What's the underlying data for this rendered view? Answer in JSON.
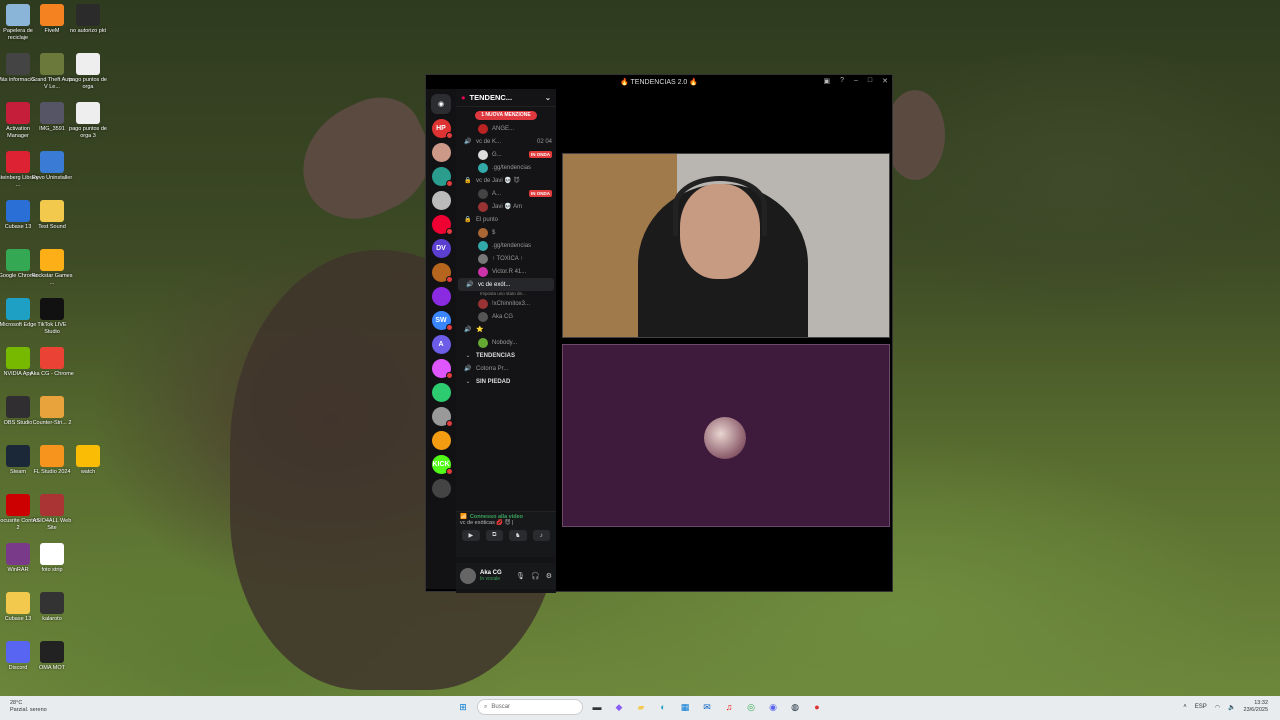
{
  "desktop_icons": [
    {
      "label": "Papelera de reciclaje",
      "icon": "recycle-bin-icon",
      "color": "#8ab4d8"
    },
    {
      "label": "FiveM",
      "icon": "fivem-icon",
      "color": "#f58220"
    },
    {
      "label": "no autorizo pkt",
      "icon": "file-icon",
      "color": "#2b2b2b"
    },
    {
      "label": "Más informació...",
      "icon": "info-icon",
      "color": "#444"
    },
    {
      "label": "Grand Theft Auto V Le...",
      "icon": "gta-icon",
      "color": "#6b7a3a"
    },
    {
      "label": "pago puntos de orga",
      "icon": "document-icon",
      "color": "#eee"
    },
    {
      "label": "Activation Manager",
      "icon": "activation-icon",
      "color": "#c41e3a"
    },
    {
      "label": "IMG_3591",
      "icon": "image-icon",
      "color": "#556"
    },
    {
      "label": "pago puntos de orga 3",
      "icon": "document-icon",
      "color": "#eee"
    },
    {
      "label": "Steinberg Library ...",
      "icon": "steinberg-icon",
      "color": "#d23"
    },
    {
      "label": "Revo Uninstaller",
      "icon": "revo-icon",
      "color": "#3a7bd5"
    },
    {
      "label": "Cubase 13",
      "icon": "cubase-icon",
      "color": "#2a6fd6"
    },
    {
      "label": "Test Sound",
      "icon": "folder-icon",
      "color": "#f2c94c"
    },
    {
      "label": "Google Chrome",
      "icon": "chrome-icon",
      "color": "#34a853"
    },
    {
      "label": "Rockstar Games ...",
      "icon": "rockstar-icon",
      "color": "#fcaf17"
    },
    {
      "label": "Microsoft Edge",
      "icon": "edge-icon",
      "color": "#1da0c3"
    },
    {
      "label": "TikTok LIVE Studio",
      "icon": "tiktok-icon",
      "color": "#111"
    },
    {
      "label": "NVIDIA App",
      "icon": "nvidia-icon",
      "color": "#76b900"
    },
    {
      "label": "Aka CG - Chrome",
      "icon": "chrome-icon",
      "color": "#ea4335"
    },
    {
      "label": "OBS Studio",
      "icon": "obs-icon",
      "color": "#302e31"
    },
    {
      "label": "Counter-Stri... 2",
      "icon": "cs2-icon",
      "color": "#e8a33d"
    },
    {
      "label": "Steam",
      "icon": "steam-icon",
      "color": "#1b2838"
    },
    {
      "label": "FL Studio 2024",
      "icon": "flstudio-icon",
      "color": "#f7941d"
    },
    {
      "label": "watch",
      "icon": "chrome-icon",
      "color": "#fbbc05"
    },
    {
      "label": "Focusrite Control 2",
      "icon": "focusrite-icon",
      "color": "#c00"
    },
    {
      "label": "ASIO4ALL Web Site",
      "icon": "asio-icon",
      "color": "#a33"
    },
    {
      "label": "WinRAR",
      "icon": "winrar-icon",
      "color": "#7a3a8a"
    },
    {
      "label": "foto strip",
      "icon": "document-icon",
      "color": "#fff"
    },
    {
      "label": "Cubase 13",
      "icon": "folder-icon",
      "color": "#f2c94c"
    },
    {
      "label": "kalaroto",
      "icon": "image-icon",
      "color": "#333"
    },
    {
      "label": "Discord",
      "icon": "discord-icon",
      "color": "#5865f2"
    },
    {
      "label": "OMA MOT",
      "icon": "image-icon",
      "color": "#222"
    }
  ],
  "window": {
    "title": "🔥 TENDENCIAS 2.0 🔥",
    "guild_name": "TENDENC...",
    "mention_pill": "1 NUOVA MENZIONE"
  },
  "servers": [
    {
      "label": "HP",
      "color": "#d33"
    },
    {
      "label": "",
      "color": "#c98"
    },
    {
      "label": "",
      "color": "#2a9d8f"
    },
    {
      "label": "",
      "color": "#bbb"
    },
    {
      "label": "",
      "color": "#e03"
    },
    {
      "label": "DV",
      "color": "#5a3fd0"
    },
    {
      "label": "",
      "color": "#b5651d"
    },
    {
      "label": "",
      "color": "#8a2be2"
    },
    {
      "label": "SW",
      "color": "#3a86ff"
    },
    {
      "label": "A",
      "color": "#6c5ce7"
    },
    {
      "label": "",
      "color": "#e056fd"
    },
    {
      "label": "",
      "color": "#2ecc71"
    },
    {
      "label": "",
      "color": "#999"
    },
    {
      "label": "",
      "color": "#f39c12"
    },
    {
      "label": "KICK",
      "color": "#53fc18"
    },
    {
      "label": "",
      "color": "#444"
    }
  ],
  "channel_list": [
    {
      "type": "user",
      "name": "ANGE...",
      "live": false,
      "avatar_color": "#b22"
    },
    {
      "type": "voice",
      "name": "vc de K...",
      "count": "02 04"
    },
    {
      "type": "user",
      "name": "G...",
      "live": true,
      "avatar_color": "#ddd"
    },
    {
      "type": "user",
      "name": ".gg/tendencias",
      "live": false,
      "avatar_color": "#3aa"
    },
    {
      "type": "locked",
      "name": "vc de Javi 💀 😈"
    },
    {
      "type": "user",
      "name": "A...",
      "live": true,
      "avatar_color": "#444"
    },
    {
      "type": "user",
      "name": "Javi 💀 Am",
      "live": false,
      "avatar_color": "#933"
    },
    {
      "type": "locked",
      "name": "El punto"
    },
    {
      "type": "user",
      "name": "$",
      "live": false,
      "avatar_color": "#a63"
    },
    {
      "type": "user",
      "name": ".gg/tendencias",
      "live": false,
      "avatar_color": "#3aa"
    },
    {
      "type": "user",
      "name": "↑ TOXICA ↑",
      "live": false,
      "avatar_color": "#777"
    },
    {
      "type": "user",
      "name": "Victor.R 41...",
      "live": false,
      "avatar_color": "#c3a"
    },
    {
      "type": "voice-active",
      "name": "vc de exót...",
      "sub": "Imposta uno stato de..."
    },
    {
      "type": "user",
      "name": "!xChinnitox3...",
      "live": false,
      "avatar_color": "#933"
    },
    {
      "type": "user",
      "name": "Aka CG",
      "live": false,
      "avatar_color": "#555"
    },
    {
      "type": "voice",
      "name": "⭐",
      "count": ""
    },
    {
      "type": "user",
      "name": "Nobody...",
      "live": false,
      "avatar_color": "#6a3"
    },
    {
      "type": "category",
      "name": "TENDENCIAS"
    },
    {
      "type": "voice",
      "name": "Cotorra Pr...",
      "count": ""
    },
    {
      "type": "category",
      "name": "SIN PIEDAD"
    }
  ],
  "voice_status": {
    "connected": "Connesso alla video",
    "channel": "vc de exóticas 💋 😈 |"
  },
  "user": {
    "name": "Aka CG",
    "status": "In vocale"
  },
  "live_label": "IN ONDA",
  "taskbar": {
    "weather_temp": "28°C",
    "weather_desc": "Parzial. sereno",
    "search_placeholder": "Buscar",
    "lang": "ESP",
    "time": "13:32",
    "date": "23/6/2025"
  }
}
